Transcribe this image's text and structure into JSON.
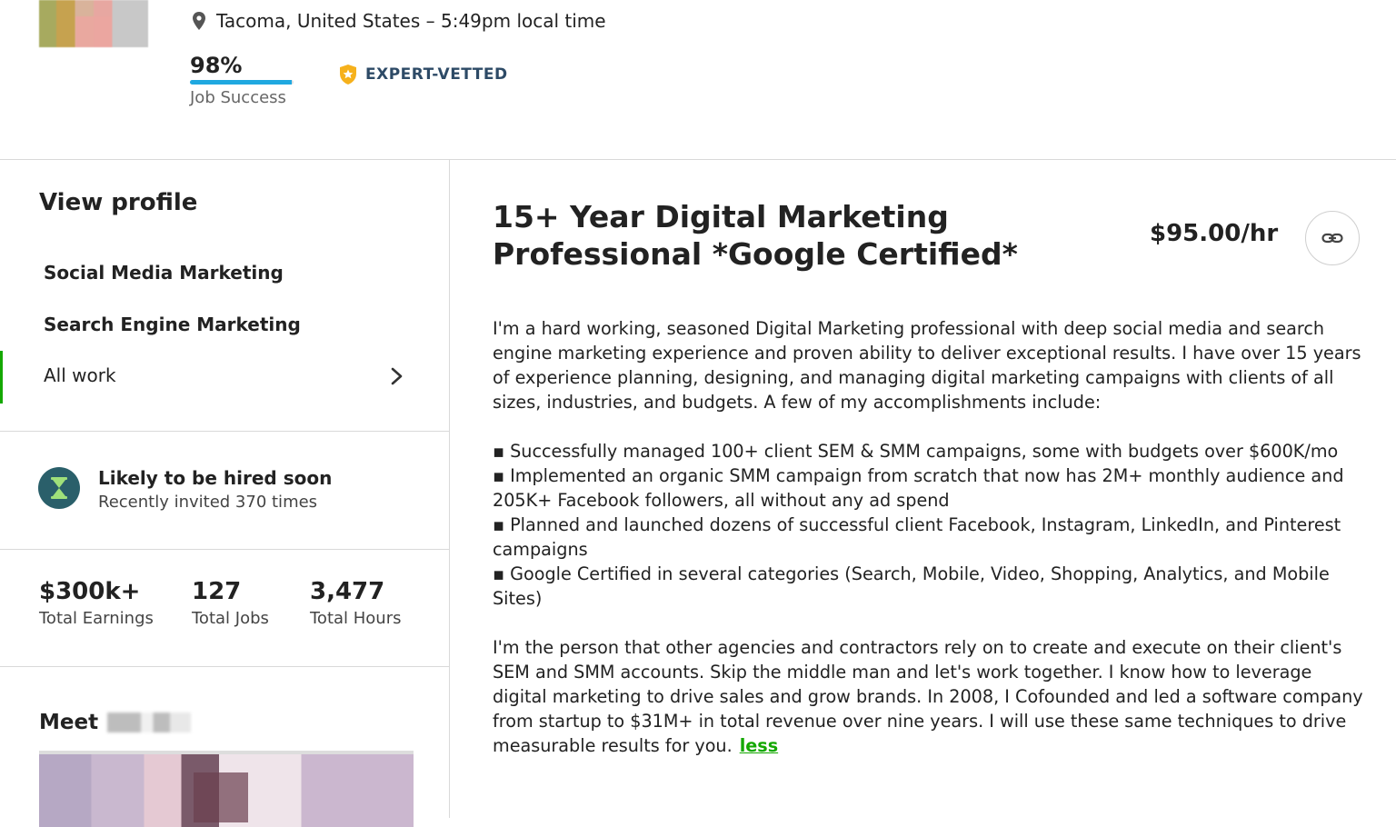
{
  "header": {
    "location": "Tacoma, United States – 5:49pm local time",
    "job_success": {
      "value": "98%",
      "percent": 98,
      "label": "Job Success"
    },
    "badge": "EXPERT-VETTED",
    "colors": {
      "badge_text": "#2d4a66",
      "badge_shield": "#f6b11c",
      "jss_bar": "#1fa8e0"
    }
  },
  "sidebar": {
    "view_profile": "View profile",
    "items": [
      {
        "label": "Social Media Marketing"
      },
      {
        "label": "Search Engine Marketing"
      },
      {
        "label": "All work",
        "active": true
      }
    ],
    "hired": {
      "title": "Likely to be hired soon",
      "subtitle": "Recently invited 370 times"
    },
    "stats": [
      {
        "value": "$300k+",
        "label": "Total Earnings"
      },
      {
        "value": "127",
        "label": "Total Jobs"
      },
      {
        "value": "3,477",
        "label": "Total Hours"
      }
    ],
    "meet_label": "Meet",
    "accent": "#14a800"
  },
  "main": {
    "title": "15+ Year Digital Marketing Professional *Google Certified*",
    "rate": "$95.00/hr",
    "intro": "I'm a hard working, seasoned Digital Marketing professional with deep social media and search engine marketing experience and proven ability to deliver exceptional results. I have over 15 years of experience planning, designing, and managing digital marketing campaigns with clients of all sizes, industries, and budgets. A few of my accomplishments include:",
    "bullets": [
      "▪ Successfully managed 100+ client SEM & SMM campaigns, some with budgets over $600K/mo",
      "▪ Implemented an organic SMM campaign from scratch that now has 2M+ monthly audience and 205K+ Facebook followers, all without any ad spend",
      "▪ Planned and launched dozens of successful client Facebook, Instagram, LinkedIn, and Pinterest campaigns",
      "▪ Google Certified in several categories (Search, Mobile, Video, Shopping, Analytics, and Mobile Sites)"
    ],
    "closing": "I'm the person that other agencies and contractors rely on to create and execute on their client's SEM and SMM accounts. Skip the middle man and let's work together. I know how to leverage digital marketing to drive sales and grow brands. In 2008, I Cofounded and led a software company from startup to $31M+ in total revenue over nine years. I will use these same techniques to drive measurable results for you.",
    "less_link": "less"
  }
}
